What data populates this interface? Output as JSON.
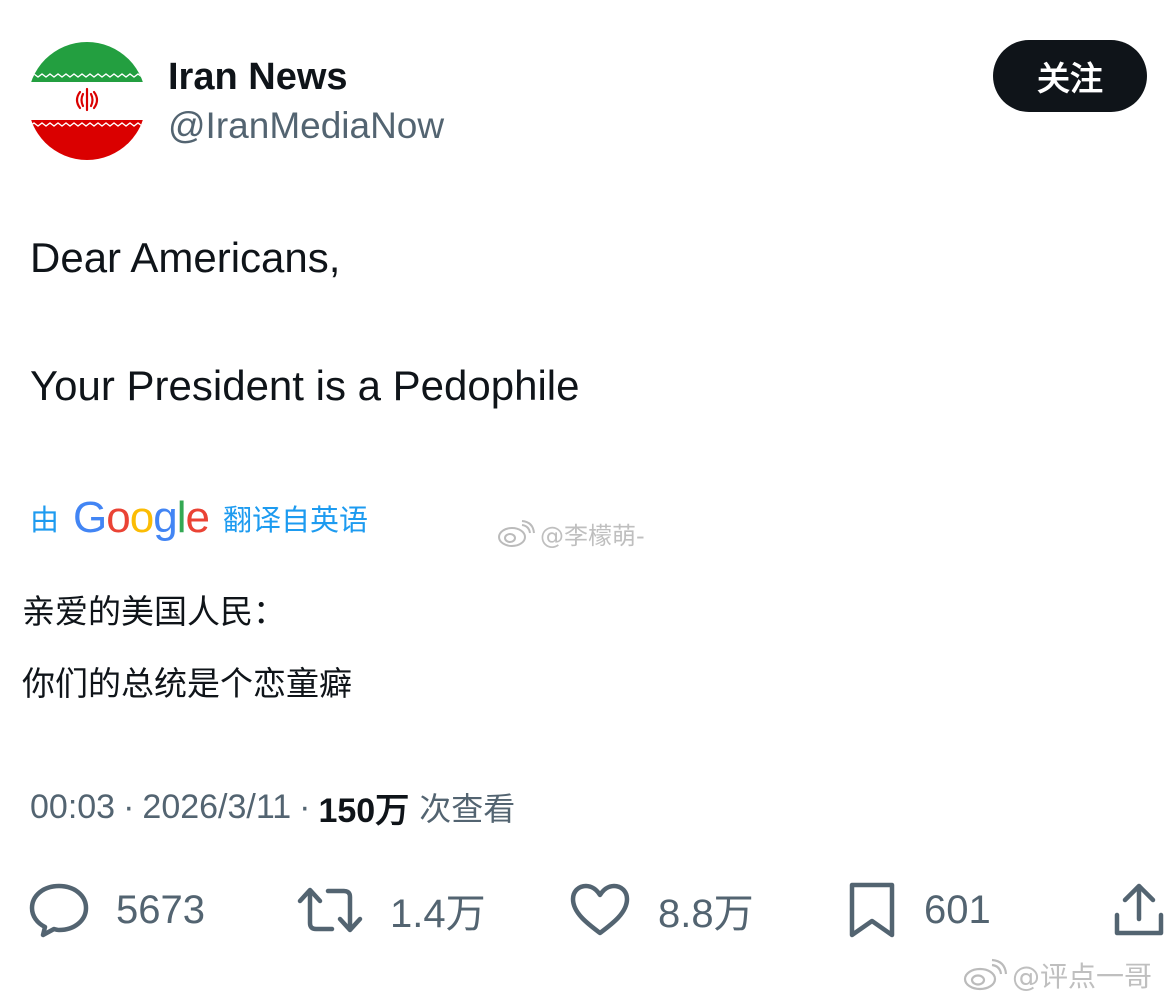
{
  "account": {
    "display_name": "Iran News",
    "handle": "@IranMediaNow",
    "follow_label": "关注"
  },
  "post": {
    "text_lines": [
      "Dear Americans,",
      "Your President is a Pedophile"
    ]
  },
  "translation": {
    "prefix": "由",
    "provider_logo_text": "Google",
    "suffix": "翻译自英语",
    "lines": [
      "亲爱的美国人民：",
      "你们的总统是个恋童癖"
    ]
  },
  "meta": {
    "time": "00:03",
    "date": "2026/3/11",
    "separator": "·",
    "views_count": "150万",
    "views_label": "次查看"
  },
  "actions": {
    "replies": "5673",
    "reposts": "1.4万",
    "likes": "8.8万",
    "bookmarks": "601"
  },
  "watermarks": [
    "@李檬萌-",
    "@评点一哥"
  ],
  "icons": {
    "avatar": "iran-flag-avatar",
    "reply": "reply-icon",
    "repost": "repost-icon",
    "like": "heart-icon",
    "bookmark": "bookmark-icon",
    "share": "share-icon",
    "watermark": "weibo-logo-icon"
  },
  "colors": {
    "text_primary": "#0f1419",
    "text_secondary": "#536471",
    "link_blue": "#1d9bf0",
    "follow_button_bg": "#0f1419",
    "flag_green": "#239f40",
    "flag_red": "#da0000",
    "google_blue": "#4285f4",
    "google_red": "#ea4335",
    "google_yellow": "#fbbc05",
    "google_green": "#34a853"
  }
}
